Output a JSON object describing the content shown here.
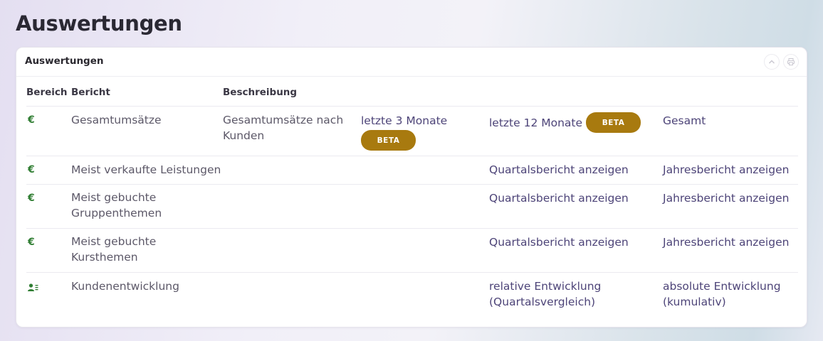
{
  "page": {
    "title": "Auswertungen"
  },
  "card": {
    "title": "Auswertungen"
  },
  "table": {
    "headers": {
      "bereich": "Bereich",
      "bericht": "Bericht",
      "beschreibung": "Beschreibung"
    },
    "rows": [
      {
        "icon": "euro-icon",
        "icon_glyph": "€",
        "report": "Gesamtumsätze",
        "description": "Gesamtumsätze nach Kunden",
        "link_a": "letzte 3 Monate",
        "link_a_badge": "BETA",
        "link_b": "letzte 12 Monate",
        "link_b_badge": "BETA",
        "link_c": "Gesamt"
      },
      {
        "icon": "euro-icon",
        "icon_glyph": "€",
        "report": "Meist verkaufte Leistungen",
        "description": "",
        "link_b": "Quartalsbericht anzeigen",
        "link_c": "Jahresbericht anzeigen"
      },
      {
        "icon": "euro-icon",
        "icon_glyph": "€",
        "report": "Meist gebuchte Gruppenthemen",
        "description": "",
        "link_b": "Quartalsbericht anzeigen",
        "link_c": "Jahresbericht anzeigen"
      },
      {
        "icon": "euro-icon",
        "icon_glyph": "€",
        "report": "Meist gebuchte Kursthemen",
        "description": "",
        "link_b": "Quartalsbericht anzeigen",
        "link_c": "Jahresbericht anzeigen"
      },
      {
        "icon": "customer-list-icon",
        "report": "Kundenentwicklung",
        "description": "",
        "link_b": "relative Entwicklung (Quartalsvergleich)",
        "link_c": "absolute Entwicklung (kumulativ)"
      }
    ]
  },
  "colors": {
    "accent": "#4d4478",
    "badge": "#a87a0f",
    "icon_green": "#2f7d32"
  }
}
